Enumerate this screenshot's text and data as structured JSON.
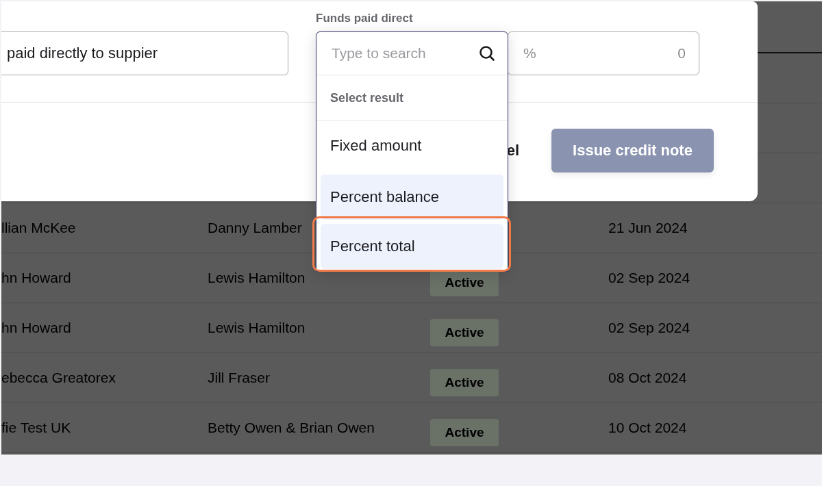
{
  "table": {
    "rows": [
      {
        "column_1": "llian McKee",
        "column_2": "Danny Lamber",
        "status": "",
        "date": "21 Jun 2024"
      },
      {
        "column_1": "hn Howard",
        "column_2": "Lewis Hamilton",
        "status": "Active",
        "date": "02 Sep 2024"
      },
      {
        "column_1": "hn Howard",
        "column_2": "Lewis Hamilton",
        "status": "Active",
        "date": "02 Sep 2024"
      },
      {
        "column_1": "ebecca Greatorex",
        "column_2": "Jill Fraser",
        "status": "Active",
        "date": "08 Oct 2024"
      },
      {
        "column_1": "fie Test UK",
        "column_2": "Betty Owen & Brian Owen",
        "status": "Active",
        "date": "10 Oct 2024"
      }
    ]
  },
  "modal": {
    "description_value": "paid directly to suppier",
    "funds_label": "Funds paid direct",
    "percent_field": {
      "prefix": "%",
      "value": "0"
    },
    "cancel_button": "el",
    "submit_button": "Issue credit note"
  },
  "dropdown": {
    "placeholder": "Type to search",
    "section_title": "Select result",
    "options": [
      {
        "label": "Fixed amount",
        "highlighted": false,
        "callout": false
      },
      {
        "label": "Percent balance",
        "highlighted": true,
        "callout": false
      },
      {
        "label": "Percent total",
        "highlighted": true,
        "callout": true
      }
    ]
  }
}
